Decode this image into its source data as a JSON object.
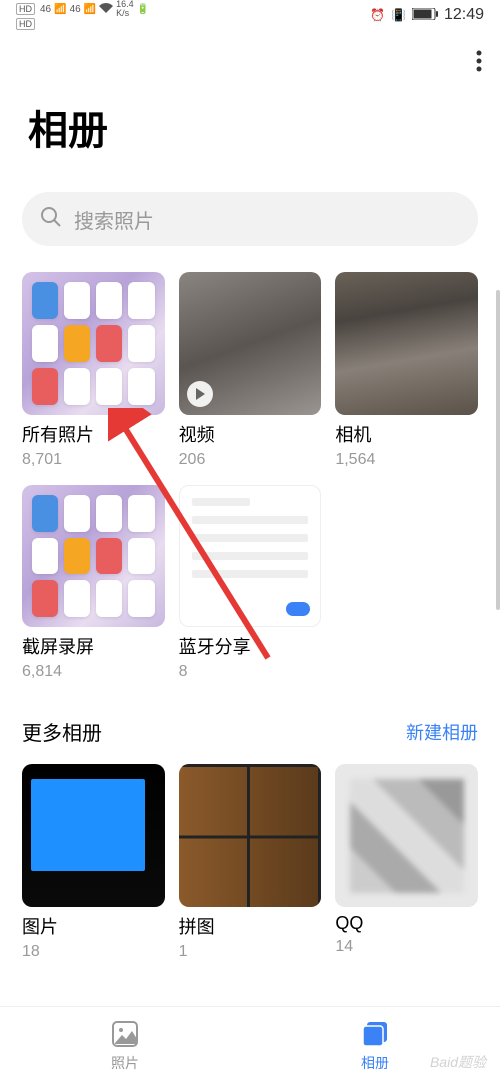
{
  "status_bar": {
    "hd1": "HD",
    "hd2": "HD",
    "sig1": "46",
    "sig2": "46",
    "speed_num": "16.4",
    "speed_unit": "K/s",
    "time": "12:49"
  },
  "title": "相册",
  "search": {
    "placeholder": "搜索照片"
  },
  "albums": [
    {
      "name": "所有照片",
      "count": "8,701",
      "thumb_type": "purple"
    },
    {
      "name": "视频",
      "count": "206",
      "thumb_type": "video"
    },
    {
      "name": "相机",
      "count": "1,564",
      "thumb_type": "camera"
    },
    {
      "name": "截屏录屏",
      "count": "6,814",
      "thumb_type": "purple"
    },
    {
      "name": "蓝牙分享",
      "count": "8",
      "thumb_type": "settings"
    }
  ],
  "more_albums": {
    "title": "更多相册",
    "action": "新建相册",
    "items": [
      {
        "name": "图片",
        "count": "18",
        "thumb_type": "desktop"
      },
      {
        "name": "拼图",
        "count": "1",
        "thumb_type": "puzzle"
      },
      {
        "name": "QQ",
        "count": "14",
        "thumb_type": "pixelated"
      }
    ]
  },
  "tabs": {
    "photos": "照片",
    "albums": "相册"
  },
  "watermark": "Baid题验"
}
